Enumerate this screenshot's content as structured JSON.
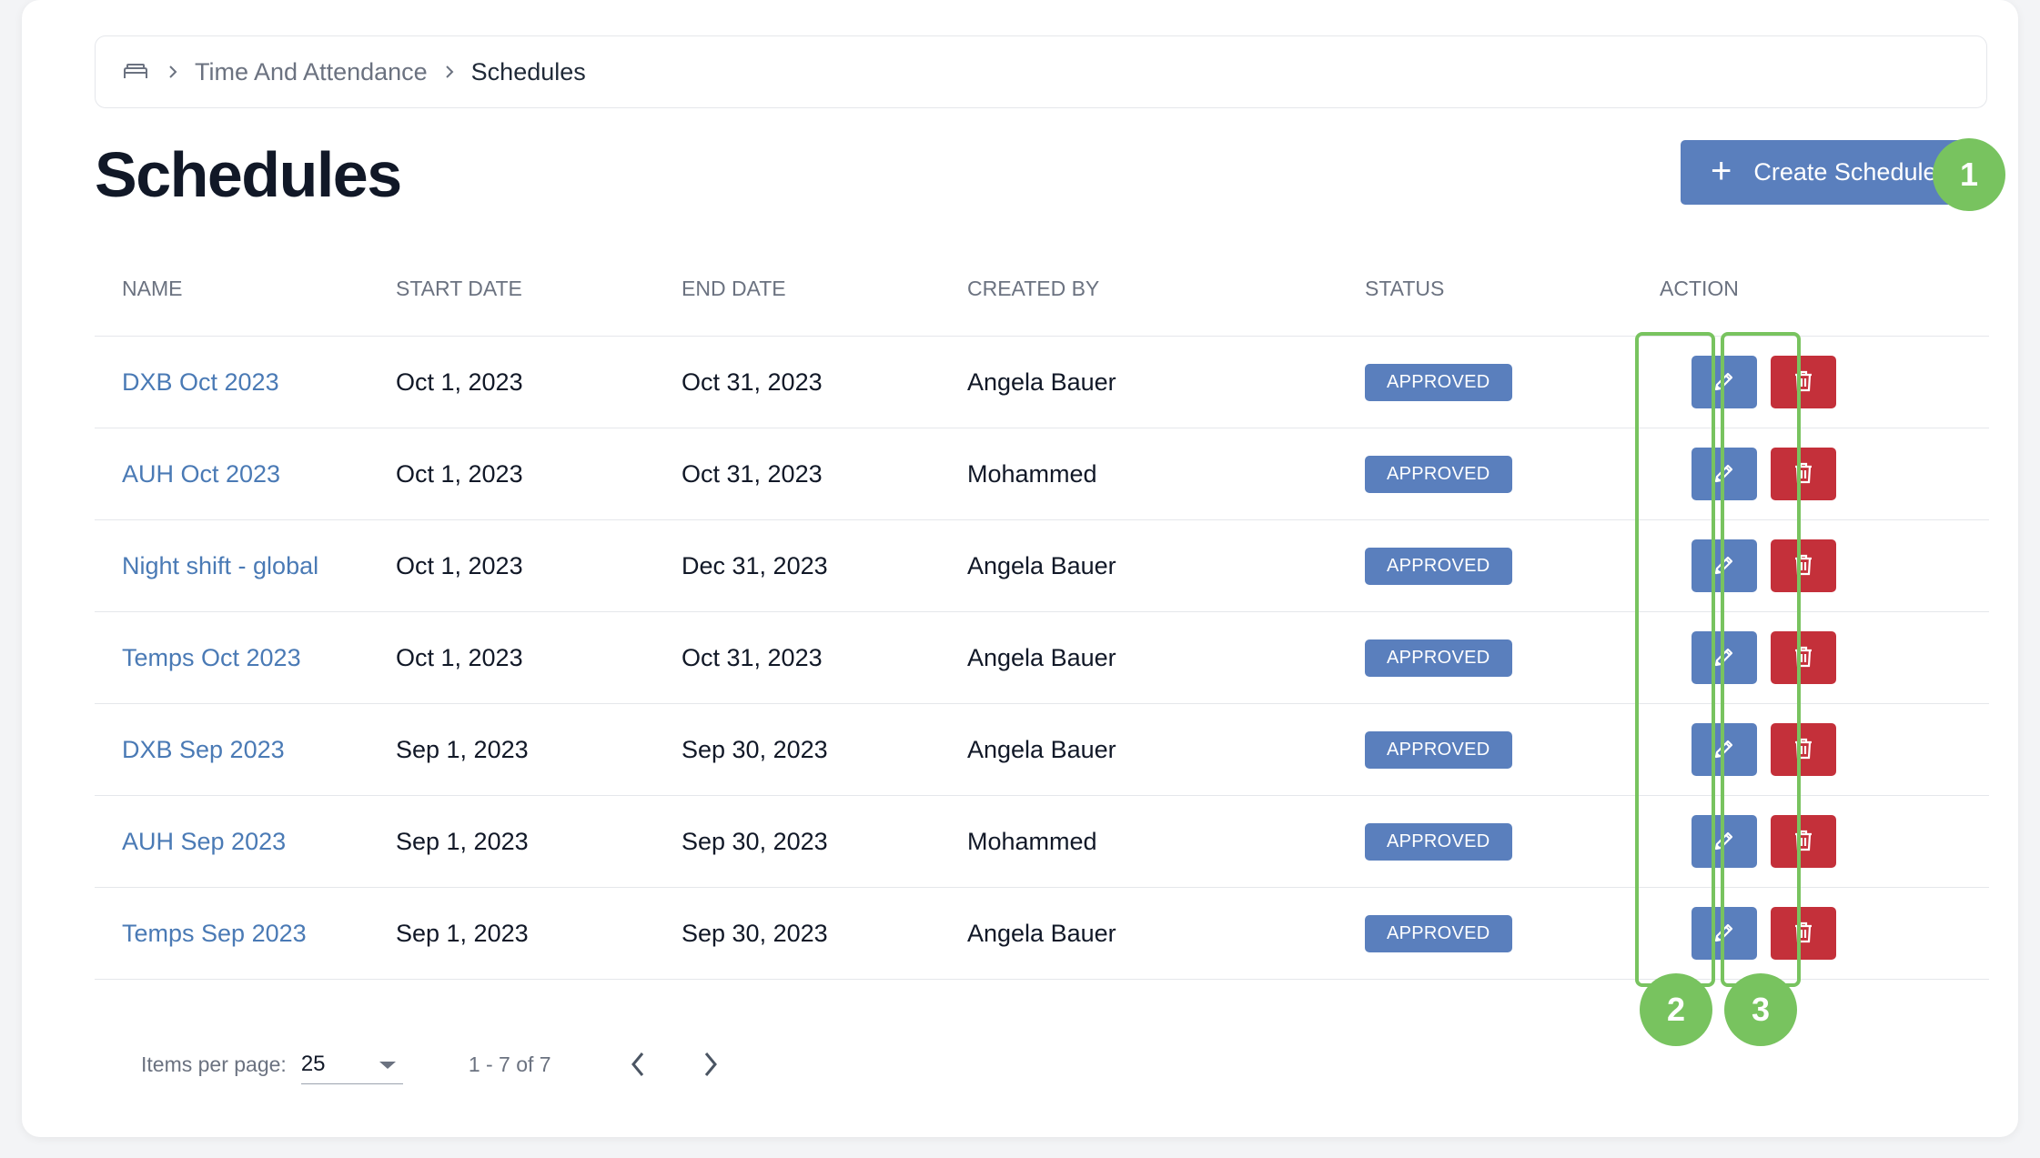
{
  "breadcrumb": {
    "home_icon": "home-icon",
    "items": [
      {
        "label": "Time And Attendance"
      },
      {
        "label": "Schedules"
      }
    ]
  },
  "page": {
    "title": "Schedules",
    "create_button_label": "Create Schedule"
  },
  "table": {
    "headers": [
      "NAME",
      "START DATE",
      "END DATE",
      "CREATED BY",
      "STATUS",
      "ACTION"
    ],
    "rows": [
      {
        "name": "DXB Oct 2023",
        "start": "Oct 1, 2023",
        "end": "Oct 31, 2023",
        "created_by": "Angela Bauer",
        "status": "APPROVED"
      },
      {
        "name": "AUH Oct 2023",
        "start": "Oct 1, 2023",
        "end": "Oct 31, 2023",
        "created_by": "Mohammed",
        "status": "APPROVED"
      },
      {
        "name": "Night shift - global",
        "start": "Oct 1, 2023",
        "end": "Dec 31, 2023",
        "created_by": "Angela Bauer",
        "status": "APPROVED"
      },
      {
        "name": "Temps Oct 2023",
        "start": "Oct 1, 2023",
        "end": "Oct 31, 2023",
        "created_by": "Angela Bauer",
        "status": "APPROVED"
      },
      {
        "name": "DXB Sep 2023",
        "start": "Sep 1, 2023",
        "end": "Sep 30, 2023",
        "created_by": "Angela Bauer",
        "status": "APPROVED"
      },
      {
        "name": "AUH Sep 2023",
        "start": "Sep 1, 2023",
        "end": "Sep 30, 2023",
        "created_by": "Mohammed",
        "status": "APPROVED"
      },
      {
        "name": "Temps Sep 2023",
        "start": "Sep 1, 2023",
        "end": "Sep 30, 2023",
        "created_by": "Angela Bauer",
        "status": "APPROVED"
      }
    ]
  },
  "annotations": {
    "labels": [
      "1",
      "2",
      "3"
    ]
  },
  "pagination": {
    "items_per_page_label": "Items per page:",
    "items_per_page_value": "25",
    "range": "1 - 7 of 7"
  },
  "colors": {
    "primary": "#5a7fbd",
    "danger": "#c4303a",
    "annotation": "#78c35f",
    "link": "#4a7ab5"
  }
}
